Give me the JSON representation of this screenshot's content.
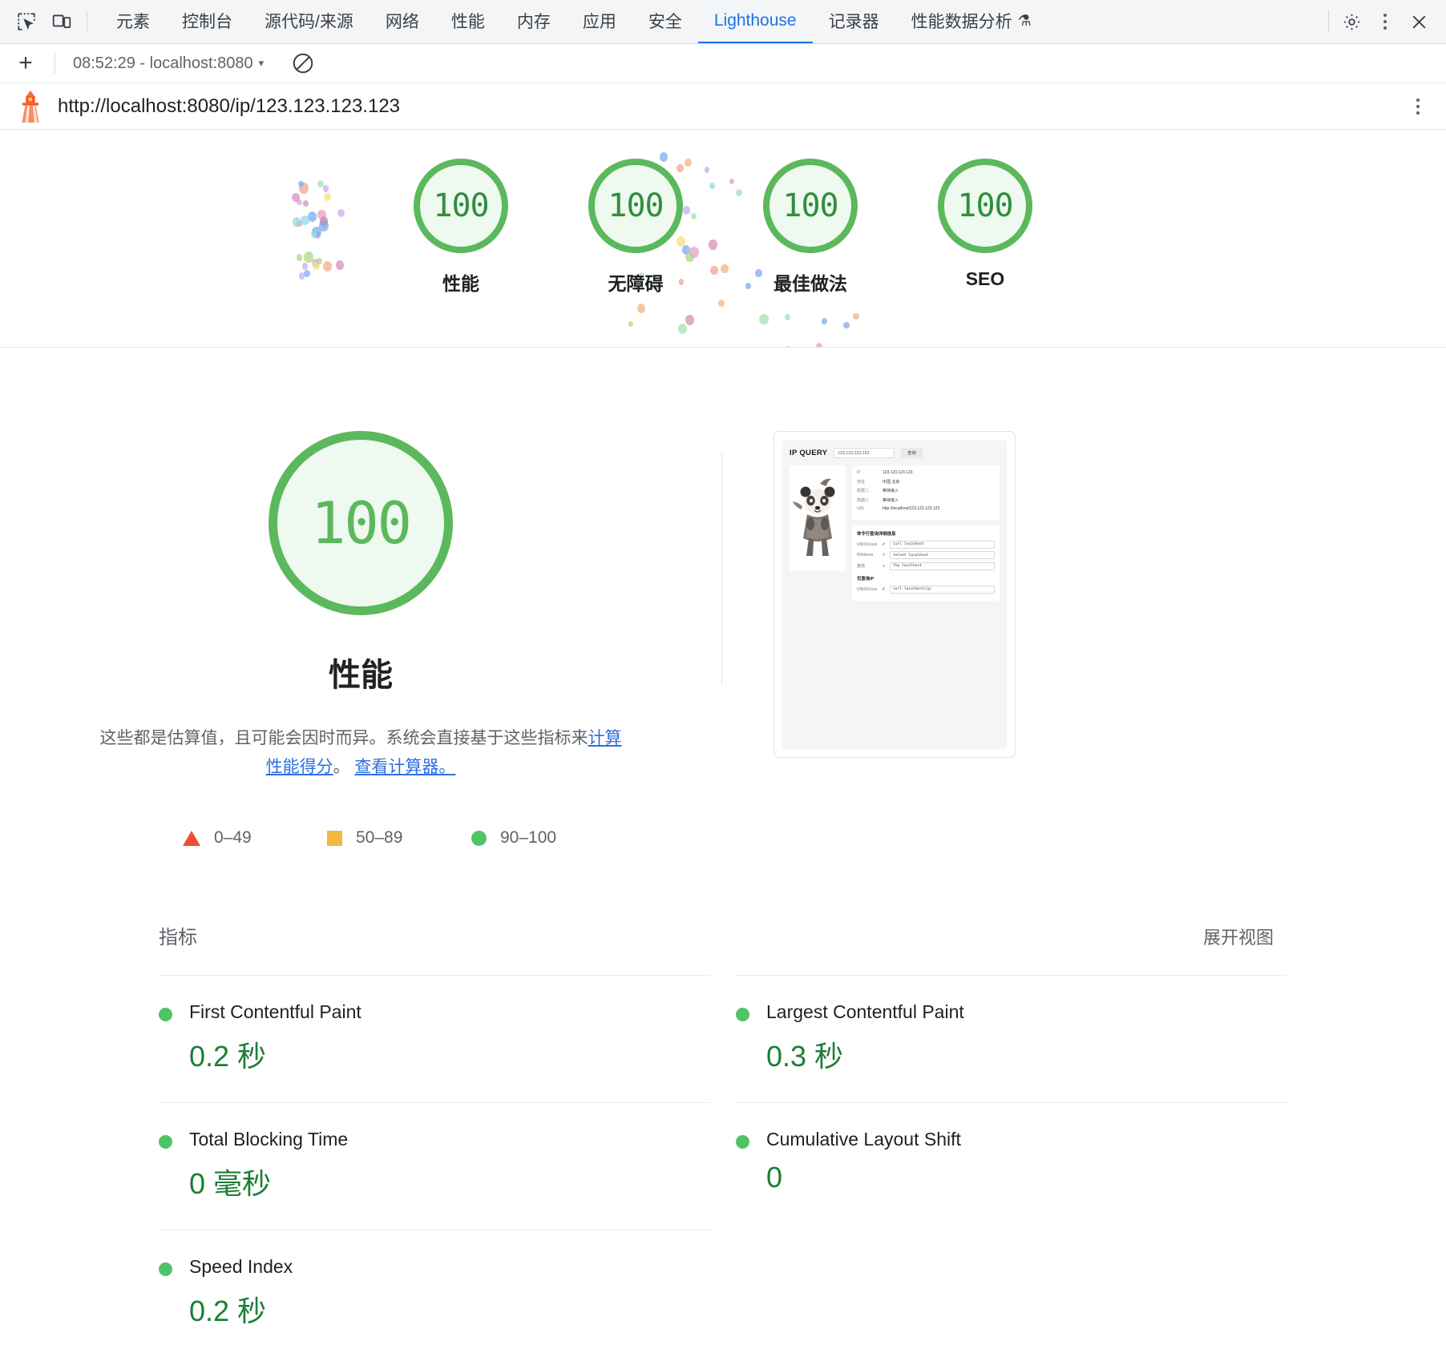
{
  "devtools": {
    "icons": [
      {
        "name": "inspect-element-icon"
      },
      {
        "name": "device-toolbar-icon"
      }
    ],
    "tabs": [
      {
        "label": "元素",
        "active": false
      },
      {
        "label": "控制台",
        "active": false
      },
      {
        "label": "源代码/来源",
        "active": false
      },
      {
        "label": "网络",
        "active": false
      },
      {
        "label": "性能",
        "active": false
      },
      {
        "label": "内存",
        "active": false
      },
      {
        "label": "应用",
        "active": false
      },
      {
        "label": "安全",
        "active": false
      },
      {
        "label": "Lighthouse",
        "active": true
      },
      {
        "label": "记录器",
        "active": false
      },
      {
        "label": "性能数据分析",
        "active": false,
        "flask": "⚗"
      }
    ],
    "right_buttons": [
      {
        "name": "settings-gear-icon",
        "glyph": "⚙"
      },
      {
        "name": "more-options-icon",
        "glyph": "⋮"
      },
      {
        "name": "close-devtools-icon",
        "glyph": "✕"
      }
    ],
    "accent_color": "#1a73e8"
  },
  "subbar": {
    "new_audit_label": "+",
    "report_selector": "08:52:29 - localhost:8080",
    "caret": "▾",
    "clear_label": "⊘"
  },
  "report_header": {
    "url": "http://localhost:8080/ip/123.123.123.123",
    "logo": "lighthouse-logo-icon",
    "menu": "report-options-icon"
  },
  "score_gauges": [
    {
      "score": "100",
      "label": "性能"
    },
    {
      "score": "100",
      "label": "无障碍"
    },
    {
      "score": "100",
      "label": "最佳做法"
    },
    {
      "score": "100",
      "label": "SEO"
    }
  ],
  "category": {
    "score": "100",
    "title": "性能",
    "desc_part1": "这些都是估算值，且可能会因时而异。系统会直接基于这些指标来",
    "desc_link1": "计算性能得分",
    "desc_part2": "。",
    "desc_link2": "查看计算器。"
  },
  "legend": [
    {
      "shape": "triangle",
      "range": "0–49",
      "color": "#f14c38"
    },
    {
      "shape": "square",
      "range": "50–89",
      "color": "#f4b942"
    },
    {
      "shape": "circle",
      "range": "90–100",
      "color": "#4fc466"
    }
  ],
  "thumbnail": {
    "brand": "IP QUERY",
    "search_value": "123.123.123.123",
    "search_button": "查询",
    "image_alt": "panda-illustration",
    "info_rows": [
      {
        "key": "IP",
        "value": "123.123.123.123"
      },
      {
        "key": "地址",
        "value": "中国 北京"
      },
      {
        "key": "数据二",
        "value": "等待接入"
      },
      {
        "key": "数据三",
        "value": "等待接入"
      },
      {
        "key": "URL",
        "value": "http://localhost/123.123.123.123"
      }
    ],
    "cmd_title": "命令行查询详细信息",
    "cmd_rows": [
      {
        "key": "UNIX/Linux",
        "sym": "#",
        "cmd": "curl localhost"
      },
      {
        "key": "Windows",
        "sym": ">",
        "cmd": "telnet localhost"
      },
      {
        "key": "其他",
        "sym": ">",
        "cmd": "ftp localhost"
      }
    ],
    "cmd_title2": "仅查询IP",
    "cmd_rows2": [
      {
        "key": "UNIX/Linux",
        "sym": "#",
        "cmd": "curl localhost/ip"
      }
    ]
  },
  "metrics": {
    "title": "指标",
    "expand_label": "展开视图",
    "left": [
      {
        "name": "First Contentful Paint",
        "value": "0.2 秒",
        "status": "pass"
      },
      {
        "name": "Total Blocking Time",
        "value": "0 毫秒",
        "status": "pass"
      },
      {
        "name": "Speed Index",
        "value": "0.2 秒",
        "status": "pass"
      }
    ],
    "right": [
      {
        "name": "Largest Contentful Paint",
        "value": "0.3 秒",
        "status": "pass"
      },
      {
        "name": "Cumulative Layout Shift",
        "value": "0",
        "status": "pass"
      }
    ]
  },
  "colors": {
    "pass_green": "#4fc466",
    "gauge_stroke": "#5cb85c",
    "value_green": "#1c7e37",
    "link_blue": "#2d6fe0"
  },
  "confetti_colors": [
    "#7aa8f0",
    "#e89ac4",
    "#f0b07a",
    "#9fe0b0",
    "#c9a8ef",
    "#f3e07a",
    "#8fd8e8",
    "#d58ab8",
    "#a8d87a",
    "#f0a08a"
  ]
}
